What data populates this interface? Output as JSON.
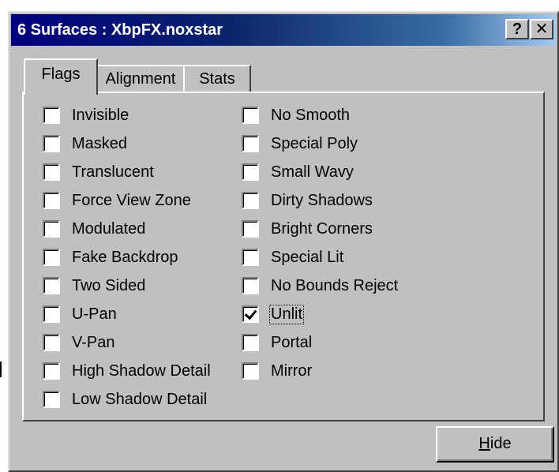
{
  "window": {
    "title": "6 Surfaces :  XbpFX.noxstar",
    "help_label": "?",
    "close_label": "✕"
  },
  "tabs": [
    {
      "label": "Flags",
      "active": true
    },
    {
      "label": "Alignment",
      "active": false
    },
    {
      "label": "Stats",
      "active": false
    }
  ],
  "flags": {
    "left": [
      {
        "label": "Invisible",
        "checked": false
      },
      {
        "label": "Masked",
        "checked": false
      },
      {
        "label": "Translucent",
        "checked": false
      },
      {
        "label": "Force View Zone",
        "checked": false
      },
      {
        "label": "Modulated",
        "checked": false
      },
      {
        "label": "Fake Backdrop",
        "checked": false
      },
      {
        "label": "Two Sided",
        "checked": false
      },
      {
        "label": "U-Pan",
        "checked": false
      },
      {
        "label": "V-Pan",
        "checked": false
      },
      {
        "label": "High Shadow Detail",
        "checked": false
      },
      {
        "label": "Low Shadow Detail",
        "checked": false
      }
    ],
    "right": [
      {
        "label": "No Smooth",
        "checked": false
      },
      {
        "label": "Special Poly",
        "checked": false
      },
      {
        "label": "Small Wavy",
        "checked": false
      },
      {
        "label": "Dirty Shadows",
        "checked": false
      },
      {
        "label": "Bright Corners",
        "checked": false
      },
      {
        "label": "Special Lit",
        "checked": false
      },
      {
        "label": "No Bounds Reject",
        "checked": false
      },
      {
        "label": "Unlit",
        "checked": true,
        "focused": true
      },
      {
        "label": "Portal",
        "checked": false
      },
      {
        "label": "Mirror",
        "checked": false
      }
    ]
  },
  "buttons": {
    "hide_accel": "H",
    "hide_rest": "ide"
  }
}
